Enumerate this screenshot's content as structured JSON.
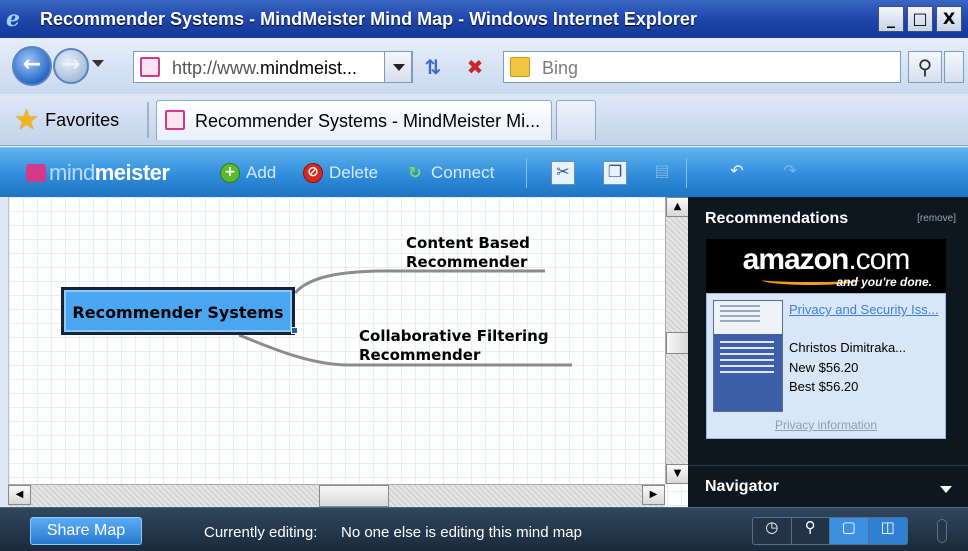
{
  "browser": {
    "title": "Recommender Systems - MindMeister Mind Map - Windows Internet Explorer",
    "window_buttons": {
      "minimize": "_",
      "maximize": "□",
      "close": "X"
    },
    "address": {
      "prefix": "http://www.",
      "domain": "mindmeist..."
    },
    "search": {
      "placeholder": "Bing"
    },
    "favorites_label": "Favorites",
    "tab_title": "Recommender Systems - MindMeister Mi..."
  },
  "toolbar": {
    "logo_light": "mind",
    "logo_bold": "meister",
    "add_label": "Add",
    "delete_label": "Delete",
    "connect_label": "Connect"
  },
  "mindmap": {
    "root": "Recommender Systems",
    "children": [
      {
        "line1": "Content Based",
        "line2": "Recommender"
      },
      {
        "line1": "Collaborative Filtering",
        "line2": "Recommender"
      }
    ]
  },
  "recommendations": {
    "title": "Recommendations",
    "remove_label": "[remove]",
    "ad_brand": "amazon",
    "ad_brand_suffix": ".com",
    "ad_tagline": "and you're done.",
    "product": {
      "title": "Privacy and Security Iss...",
      "author": "Christos Dimitraka...",
      "new_price": "New $56.20",
      "best_price": "Best $56.20"
    },
    "privacy_link": "Privacy information"
  },
  "navigator": {
    "title": "Navigator"
  },
  "status": {
    "share_label": "Share Map",
    "editing_label": "Currently editing:",
    "editing_value": "No one else is editing this mind map"
  },
  "colors": {
    "toolbar_blue": "#2e8ad8",
    "root_fill": "#4aa6f0",
    "panel_dark": "#0d1720",
    "amazon_orange": "#f19f1a"
  }
}
